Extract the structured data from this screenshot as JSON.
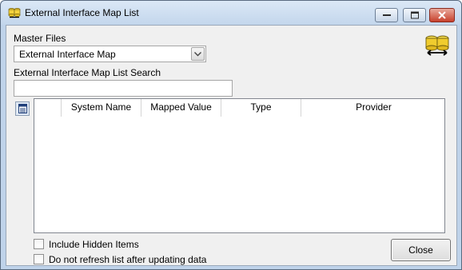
{
  "window": {
    "title": "External Interface Map List",
    "title_icon": "database-link-icon",
    "controls": [
      "minimize-icon",
      "maximize-icon",
      "close-icon"
    ]
  },
  "master_files": {
    "label": "Master Files",
    "selected": "External Interface Map"
  },
  "search": {
    "label": "External Interface Map List Search",
    "value": "",
    "placeholder": ""
  },
  "grid": {
    "columns": [
      "",
      "System Name",
      "Mapped Value",
      "Type",
      "Provider"
    ],
    "rows": []
  },
  "options": {
    "include_hidden": {
      "label": "Include Hidden Items",
      "checked": false
    },
    "no_refresh": {
      "label": "Do not refresh list after updating data",
      "checked": false
    }
  },
  "buttons": {
    "close": "Close"
  },
  "icons": {
    "sync": "database-sync-icon",
    "columns": "column-chooser-icon"
  },
  "colors": {
    "titlebar": "#c9dbef",
    "client": "#f0f0f0",
    "close_button": "#c7402c"
  }
}
